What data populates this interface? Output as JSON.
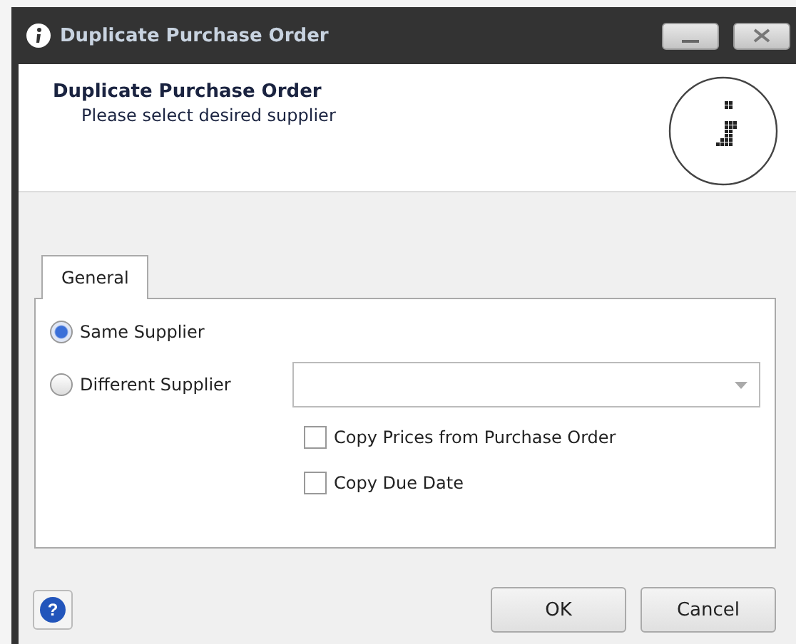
{
  "window": {
    "title": "Duplicate Purchase Order"
  },
  "header": {
    "title": "Duplicate Purchase Order",
    "subtitle": "Please select desired supplier"
  },
  "tabs": [
    {
      "label": "General",
      "selected": true
    }
  ],
  "options": [
    {
      "kind": "radio",
      "label": "Same Supplier",
      "selected": true
    },
    {
      "kind": "radio",
      "label": "Different Supplier",
      "selected": false
    },
    {
      "kind": "checkbox",
      "label": "Copy Prices from Purchase Order",
      "checked": false
    },
    {
      "kind": "checkbox",
      "label": "Copy Due Date",
      "checked": false
    }
  ],
  "help_button": "?",
  "buttons": [
    "OK",
    "Cancel"
  ]
}
